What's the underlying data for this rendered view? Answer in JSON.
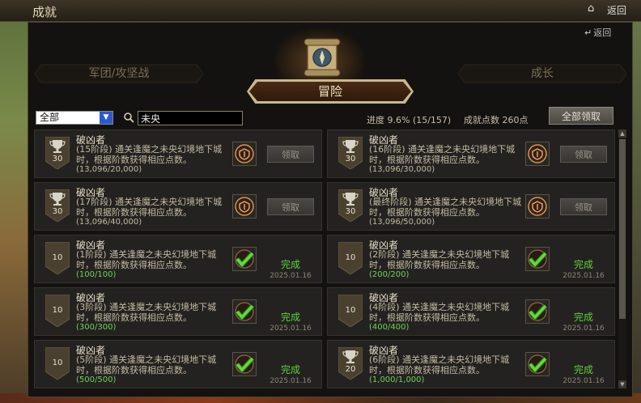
{
  "window": {
    "title": "成就",
    "home_icon": "home-icon",
    "back_label": "返回"
  },
  "panel": {
    "back_small_label": "返回"
  },
  "tabs": {
    "left": "军团/攻坚战",
    "active": "冒险",
    "right": "成长"
  },
  "filter": {
    "category_value": "全部",
    "search_value": "未央",
    "search_icon": "search-icon"
  },
  "summary": {
    "progress_text": "进度  9.6% (15/157)",
    "points_text": "成就点数 260点"
  },
  "claim_all_label": "全部领取",
  "achievements": [
    {
      "title": "破凶者",
      "stage": "(15阶段)",
      "desc": "通关逢魔之未央幻境地下城时，根据阶数获得相应点数。",
      "progress": "(13,096/20,000)",
      "points": "30",
      "badge": "trophy",
      "status": "pending",
      "claim_label": "领取",
      "date": ""
    },
    {
      "title": "破凶者",
      "stage": "(16阶段)",
      "desc": "通关逢魔之未央幻境地下城时，根据阶数获得相应点数。",
      "progress": "(13,096/30,000)",
      "points": "30",
      "badge": "trophy",
      "status": "pending",
      "claim_label": "领取",
      "date": ""
    },
    {
      "title": "破凶者",
      "stage": "(17阶段)",
      "desc": "通关逢魔之未央幻境地下城时，根据阶数获得相应点数。",
      "progress": "(13,096/40,000)",
      "points": "30",
      "badge": "trophy",
      "status": "pending",
      "claim_label": "领取",
      "date": ""
    },
    {
      "title": "破凶者",
      "stage": "(最终阶段)",
      "desc": "通关逢魔之未央幻境地下城时，根据阶数获得相应点数。",
      "progress": "(13,096/50,000)",
      "points": "30",
      "badge": "trophy",
      "status": "pending",
      "claim_label": "领取",
      "date": ""
    },
    {
      "title": "破凶者",
      "stage": "(1阶段)",
      "desc": "通关逢魔之未央幻境地下城时，根据阶数获得相应点数。",
      "progress": "(100/100)",
      "points": "10",
      "badge": "plain",
      "status": "done",
      "done_label": "完成",
      "date": "2025.01.16"
    },
    {
      "title": "破凶者",
      "stage": "(2阶段)",
      "desc": "通关逢魔之未央幻境地下城时，根据阶数获得相应点数。",
      "progress": "(200/200)",
      "points": "10",
      "badge": "plain",
      "status": "done",
      "done_label": "完成",
      "date": "2025.01.16"
    },
    {
      "title": "破凶者",
      "stage": "(3阶段)",
      "desc": "通关逢魔之未央幻境地下城时，根据阶数获得相应点数。",
      "progress": "(300/300)",
      "points": "10",
      "badge": "plain",
      "status": "done",
      "done_label": "完成",
      "date": "2025.01.16"
    },
    {
      "title": "破凶者",
      "stage": "(4阶段)",
      "desc": "通关逢魔之未央幻境地下城时，根据阶数获得相应点数。",
      "progress": "(400/400)",
      "points": "10",
      "badge": "plain",
      "status": "done",
      "done_label": "完成",
      "date": "2025.01.16"
    },
    {
      "title": "破凶者",
      "stage": "(5阶段)",
      "desc": "通关逢魔之未央幻境地下城时，根据阶数获得相应点数。",
      "progress": "(500/500)",
      "points": "10",
      "badge": "plain",
      "status": "done",
      "done_label": "完成",
      "date": "2025.01.16"
    },
    {
      "title": "破凶者",
      "stage": "(6阶段)",
      "desc": "通关逢魔之未央幻境地下城时，根据阶数获得相应点数。",
      "progress": "(1,000/1,000)",
      "points": "20",
      "badge": "trophy",
      "status": "done",
      "done_label": "完成",
      "date": "2025.01.16"
    }
  ]
}
